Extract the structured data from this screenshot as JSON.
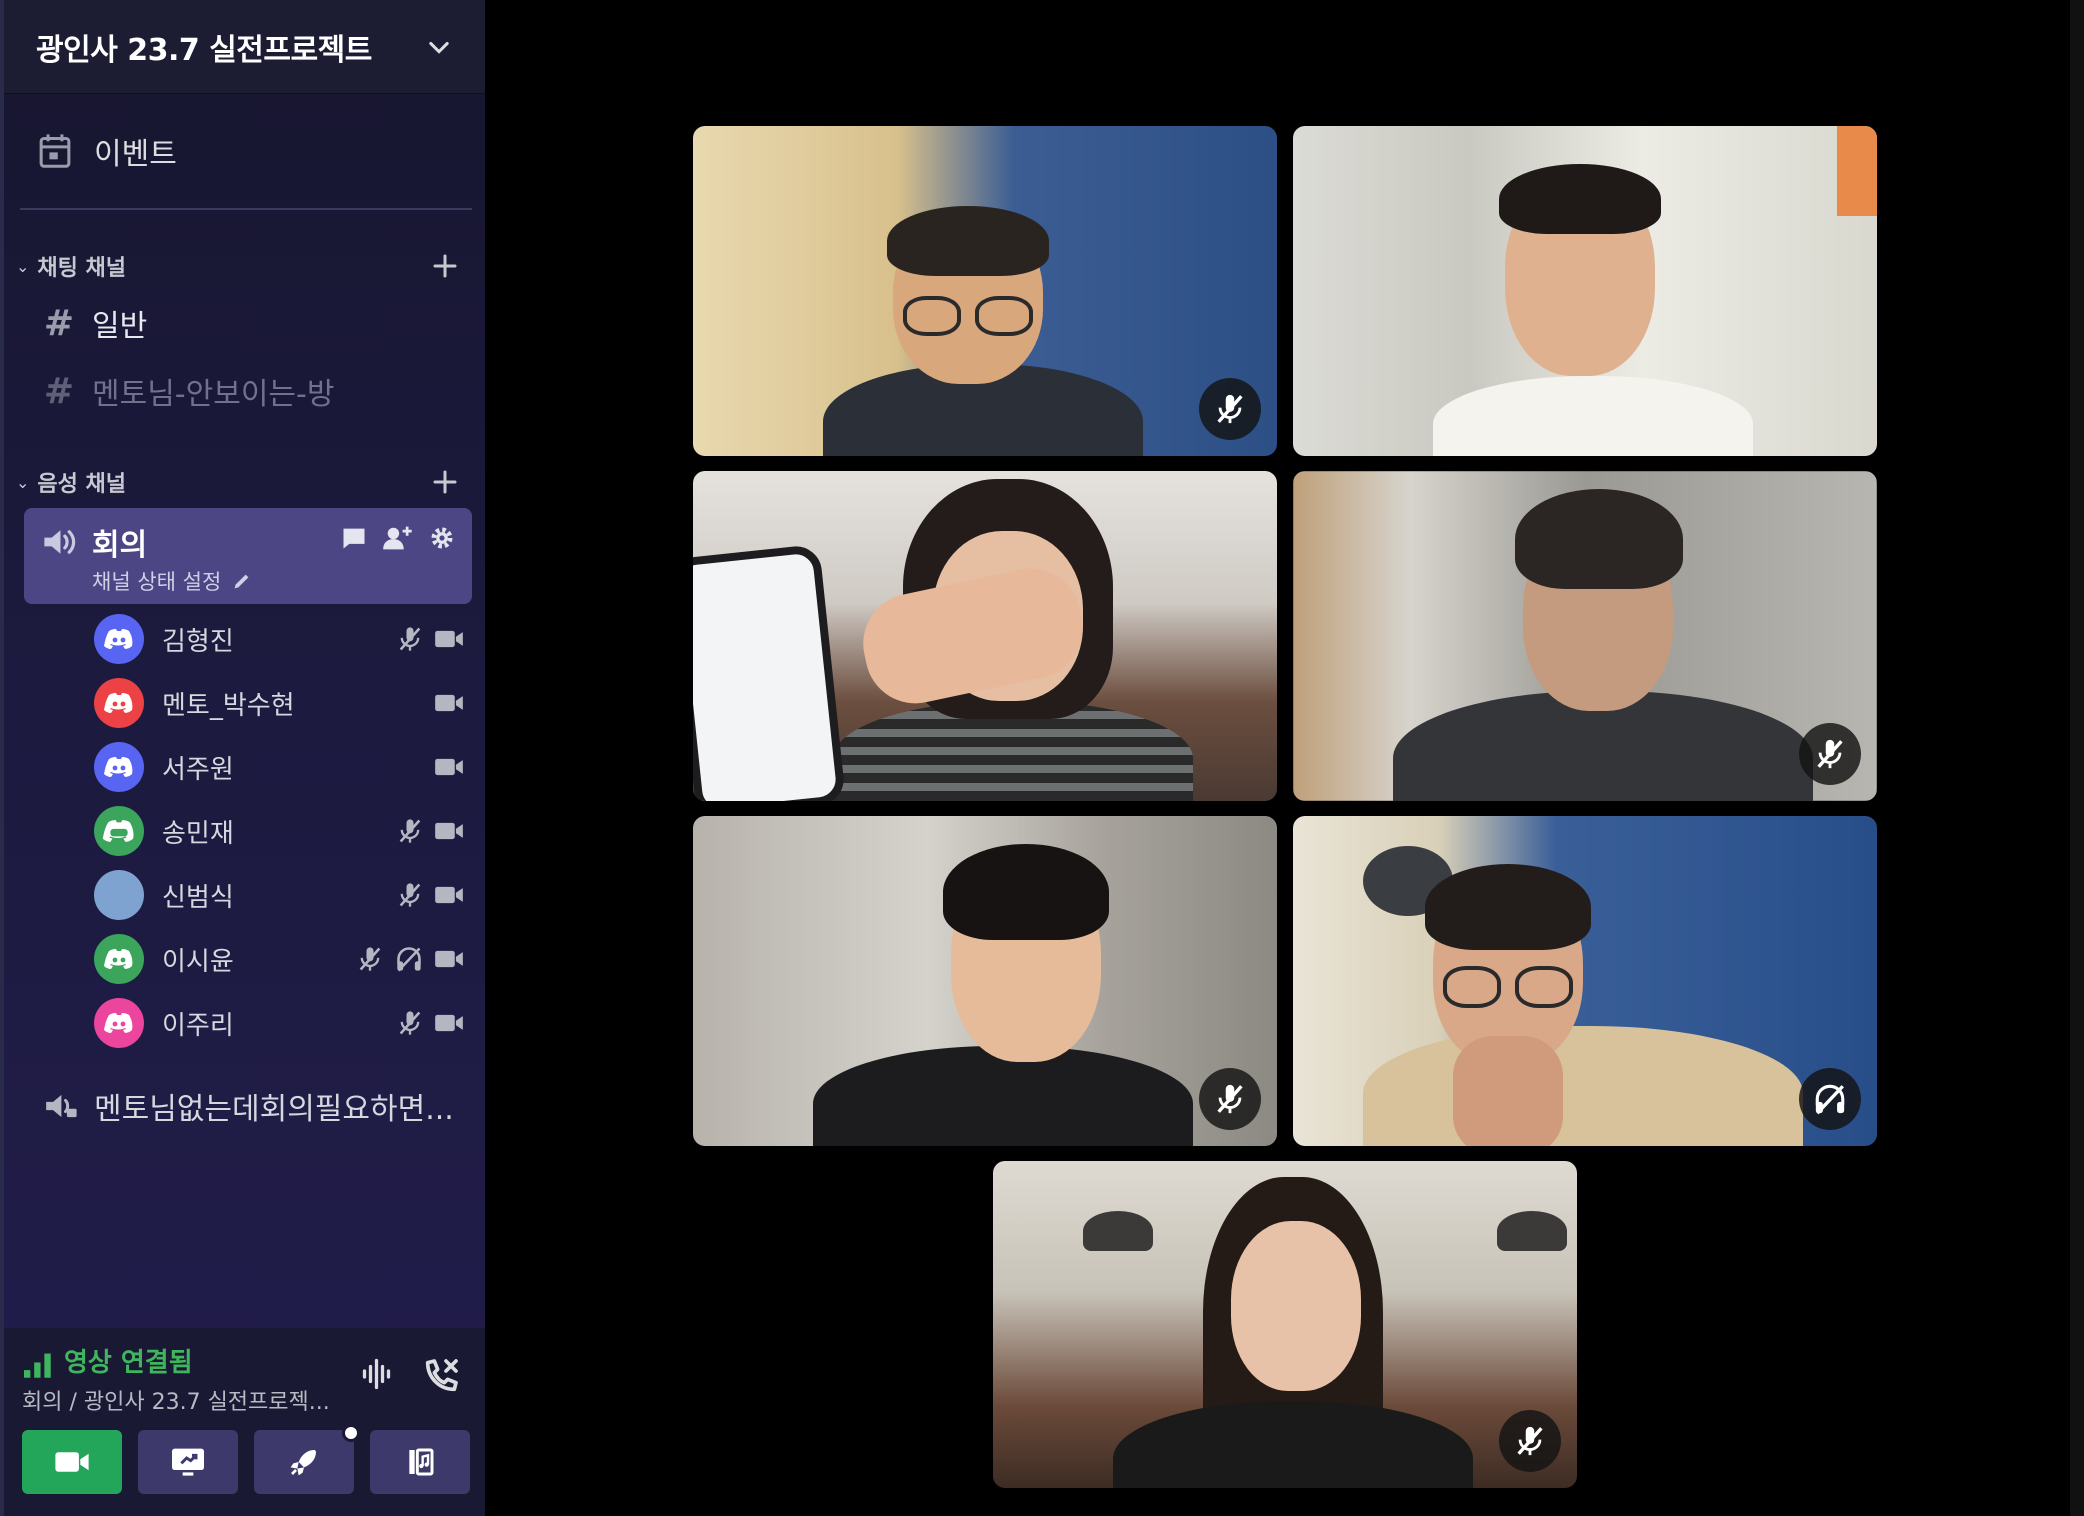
{
  "server": {
    "name": "광인사 23.7 실전프로젝트"
  },
  "events": {
    "label": "이벤트"
  },
  "text_category": {
    "label": "채팅 채널"
  },
  "text_channels": [
    {
      "label": "일반"
    },
    {
      "label": "멘토님-안보이는-방"
    }
  ],
  "voice_category": {
    "label": "음성 채널"
  },
  "active_voice": {
    "name": "회의",
    "status": "채널 상태 설정"
  },
  "participants": [
    {
      "name": "김형진",
      "avatar_color": "#5865f2",
      "muted": true,
      "deafened": false,
      "video": true
    },
    {
      "name": "멘토_박수현",
      "avatar_color": "#ed4245",
      "muted": false,
      "deafened": false,
      "video": true
    },
    {
      "name": "서주원",
      "avatar_color": "#5865f2",
      "muted": false,
      "deafened": false,
      "video": true
    },
    {
      "name": "송민재",
      "avatar_color": "#3ba55c",
      "muted": true,
      "deafened": false,
      "video": true
    },
    {
      "name": "신범식",
      "avatar_color": "#7ea3d1",
      "muted": true,
      "deafened": false,
      "video": true
    },
    {
      "name": "이시윤",
      "avatar_color": "#3ba55c",
      "muted": true,
      "deafened": true,
      "video": true
    },
    {
      "name": "이주리",
      "avatar_color": "#eb459e",
      "muted": true,
      "deafened": false,
      "video": true
    }
  ],
  "other_voice": {
    "label": "멘토님없는데회의필요하면..."
  },
  "connection": {
    "status": "영상 연결됨",
    "location": "회의 / 광인사 23.7 실전프로젝...",
    "status_color": "#3fb55d"
  },
  "video_tiles": [
    {
      "badge": "muted"
    },
    {
      "badge": "none"
    },
    {
      "badge": "none"
    },
    {
      "badge": "muted"
    },
    {
      "badge": "muted"
    },
    {
      "badge": "deafened"
    },
    {
      "badge": "muted"
    }
  ]
}
